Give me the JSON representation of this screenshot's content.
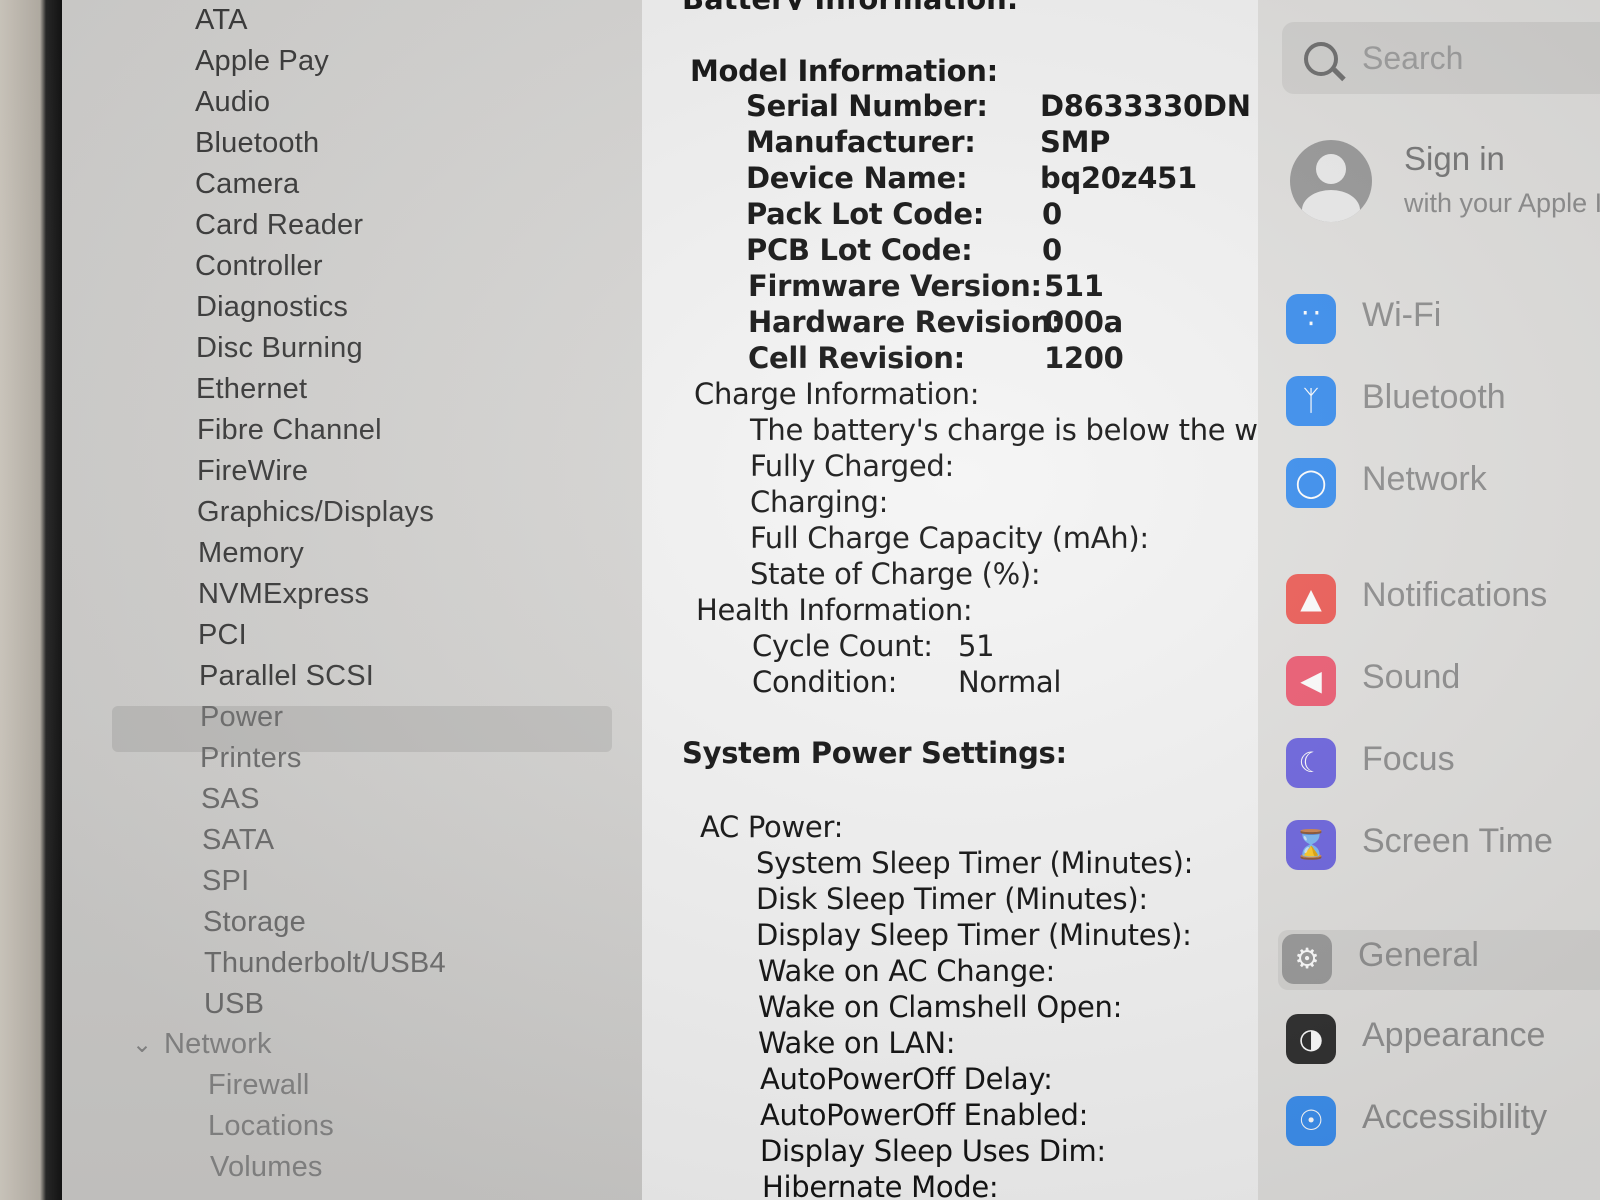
{
  "sidebar": {
    "items": [
      {
        "label": "ATA"
      },
      {
        "label": "Apple Pay"
      },
      {
        "label": "Audio"
      },
      {
        "label": "Bluetooth"
      },
      {
        "label": "Camera"
      },
      {
        "label": "Card Reader"
      },
      {
        "label": "Controller"
      },
      {
        "label": "Diagnostics"
      },
      {
        "label": "Disc Burning"
      },
      {
        "label": "Ethernet"
      },
      {
        "label": "Fibre Channel"
      },
      {
        "label": "FireWire"
      },
      {
        "label": "Graphics/Displays"
      },
      {
        "label": "Memory"
      },
      {
        "label": "NVMExpress"
      },
      {
        "label": "PCI"
      },
      {
        "label": "Parallel SCSI"
      },
      {
        "label": "Power"
      },
      {
        "label": "Printers"
      },
      {
        "label": "SAS"
      },
      {
        "label": "SATA"
      },
      {
        "label": "SPI"
      },
      {
        "label": "Storage"
      },
      {
        "label": "Thunderbolt/USB4"
      },
      {
        "label": "USB"
      }
    ],
    "selected": "Power",
    "network_group": "Network",
    "network_items": [
      {
        "label": "Firewall"
      },
      {
        "label": "Locations"
      },
      {
        "label": "Volumes"
      }
    ]
  },
  "detail": {
    "section_title_cut": "Battery Information:",
    "model_heading": "Model Information:",
    "model": [
      {
        "key": "Serial Number:",
        "value": "D8633330DN"
      },
      {
        "key": "Manufacturer:",
        "value": "SMP"
      },
      {
        "key": "Device Name:",
        "value": "bq20z451"
      },
      {
        "key": "Pack Lot Code:",
        "value": "0"
      },
      {
        "key": "PCB Lot Code:",
        "value": "0"
      },
      {
        "key": "Firmware Version:",
        "value": "511"
      },
      {
        "key": "Hardware Revision:",
        "value": "000a"
      },
      {
        "key": "Cell Revision:",
        "value": "1200"
      }
    ],
    "charge_heading": "Charge Information:",
    "charge_note": "The battery's charge is below the w",
    "charge_rows": [
      {
        "key": "Fully Charged:"
      },
      {
        "key": "Charging:"
      },
      {
        "key": "Full Charge Capacity (mAh):"
      },
      {
        "key": "State of Charge (%):"
      }
    ],
    "health_heading": "Health Information:",
    "health": [
      {
        "key": "Cycle Count:",
        "value": "51"
      },
      {
        "key": "Condition:",
        "value": "Normal"
      }
    ],
    "power_settings_heading": "System Power Settings:",
    "ac_heading": "AC Power:",
    "ac_rows": [
      {
        "key": "System Sleep Timer (Minutes):"
      },
      {
        "key": "Disk Sleep Timer (Minutes):"
      },
      {
        "key": "Display Sleep Timer (Minutes):"
      },
      {
        "key": "Wake on AC Change:"
      },
      {
        "key": "Wake on Clamshell Open:"
      },
      {
        "key": "Wake on LAN:"
      },
      {
        "key": "AutoPowerOff Delay:"
      },
      {
        "key": "AutoPowerOff Enabled:"
      },
      {
        "key": "Display Sleep Uses Dim:"
      },
      {
        "key": "Hibernate Mode:"
      }
    ]
  },
  "settings": {
    "search_placeholder": "Search",
    "signin_title": "Sign in",
    "signin_sub": "with your Apple ID",
    "items": [
      {
        "label": "Wi-Fi",
        "icon": "wifi-icon",
        "color": "#3b8ff0"
      },
      {
        "label": "Bluetooth",
        "icon": "bluetooth-icon",
        "color": "#3b8ff0"
      },
      {
        "label": "Network",
        "icon": "globe-icon",
        "color": "#3b8ff0"
      },
      {
        "label": "Notifications",
        "icon": "bell-icon",
        "color": "#ee5d57"
      },
      {
        "label": "Sound",
        "icon": "speaker-icon",
        "color": "#ee5d74"
      },
      {
        "label": "Focus",
        "icon": "moon-icon",
        "color": "#6e66e0"
      },
      {
        "label": "Screen Time",
        "icon": "hourglass-icon",
        "color": "#6e66e0"
      },
      {
        "label": "General",
        "icon": "gear-icon",
        "color": "#9a9a9a"
      },
      {
        "label": "Appearance",
        "icon": "appearance-icon",
        "color": "#2e2e2e"
      },
      {
        "label": "Accessibility",
        "icon": "accessibility-icon",
        "color": "#3b8ff0"
      }
    ],
    "selected": "General"
  }
}
